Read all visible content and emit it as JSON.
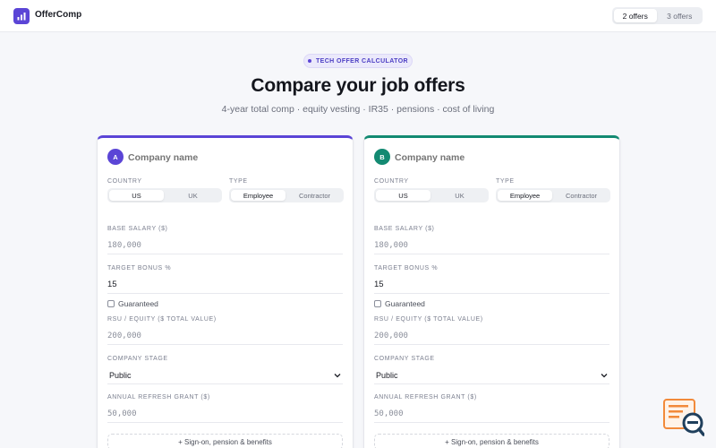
{
  "app": {
    "brand": "OfferComp"
  },
  "offers_toggle": [
    {
      "label": "2 offers",
      "active": true
    },
    {
      "label": "3 offers",
      "active": false
    }
  ],
  "hero": {
    "pill": "TECH OFFER CALCULATOR",
    "title": "Compare your job offers",
    "subtitle": "4-year total comp · equity vesting · IR35 · pensions · cost of living"
  },
  "labels": {
    "country": "COUNTRY",
    "type": "TYPE",
    "base_salary": "BASE SALARY ($)",
    "target_bonus": "TARGET BONUS %",
    "guaranteed": "Guaranteed",
    "rsu": "RSU / EQUITY ($ TOTAL VALUE)",
    "company_stage": "COMPANY STAGE",
    "refresh": "ANNUAL REFRESH GRANT ($)",
    "more": "+ Sign-on, pension & benefits"
  },
  "colors": {
    "accent_a": "#5b45d6",
    "accent_b": "#138a72"
  },
  "offers": [
    {
      "letter": "A",
      "company_placeholder": "Company name",
      "country_options": [
        "US",
        "UK"
      ],
      "country_active": "US",
      "type_options": [
        "Employee",
        "Contractor"
      ],
      "type_active": "Employee",
      "base_salary_placeholder": "180,000",
      "target_bonus": "15",
      "rsu_placeholder": "200,000",
      "company_stage": "Public",
      "refresh_placeholder": "50,000"
    },
    {
      "letter": "B",
      "company_placeholder": "Company name",
      "country_options": [
        "US",
        "UK"
      ],
      "country_active": "US",
      "type_options": [
        "Employee",
        "Contractor"
      ],
      "type_active": "Employee",
      "base_salary_placeholder": "180,000",
      "target_bonus": "15",
      "rsu_placeholder": "200,000",
      "company_stage": "Public",
      "refresh_placeholder": "50,000"
    }
  ]
}
